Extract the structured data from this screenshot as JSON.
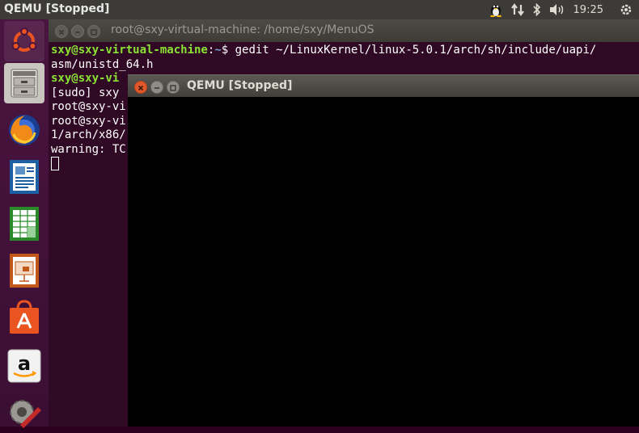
{
  "panel": {
    "app_title": "QEMU [Stopped]",
    "clock": "19:25",
    "tray_icons": [
      "tux-icon",
      "network-updown-icon",
      "bluetooth-icon",
      "volume-icon",
      "power-gear-icon"
    ]
  },
  "launcher": {
    "items": [
      {
        "name": "ubuntu-dash",
        "icon": "ubuntu-logo-icon"
      },
      {
        "name": "files",
        "icon": "file-cabinet-icon"
      },
      {
        "name": "firefox",
        "icon": "firefox-icon"
      },
      {
        "name": "libreoffice-writer",
        "icon": "writer-icon"
      },
      {
        "name": "libreoffice-calc",
        "icon": "calc-icon"
      },
      {
        "name": "libreoffice-impress",
        "icon": "impress-icon"
      },
      {
        "name": "ubuntu-software",
        "icon": "software-bag-icon"
      },
      {
        "name": "amazon",
        "icon": "amazon-icon"
      },
      {
        "name": "system-settings",
        "icon": "settings-wrench-icon"
      }
    ]
  },
  "terminal": {
    "title": "root@sxy-virtual-machine: /home/sxy/MenuOS",
    "line1_user": "sxy@sxy-virtual-machine",
    "line1_sep": ":",
    "line1_path": "~",
    "line1_cmd": "$ gedit ~/LinuxKernel/linux-5.0.1/arch/sh/include/uapi/",
    "line2": "asm/unistd_64.h",
    "line3_user": "sxy@sxy-vi",
    "line4": "[sudo] sxy",
    "line5": "root@sxy-vi",
    "line6": "root@sxy-vi",
    "line7": "1/arch/x86/",
    "line8": "warning: TC"
  },
  "qemu": {
    "title": "QEMU [Stopped]"
  },
  "colors": {
    "terminal_bg": "#300a24",
    "prompt_user": "#8ae234",
    "prompt_path": "#729fcf",
    "close_button": "#e2582d"
  }
}
